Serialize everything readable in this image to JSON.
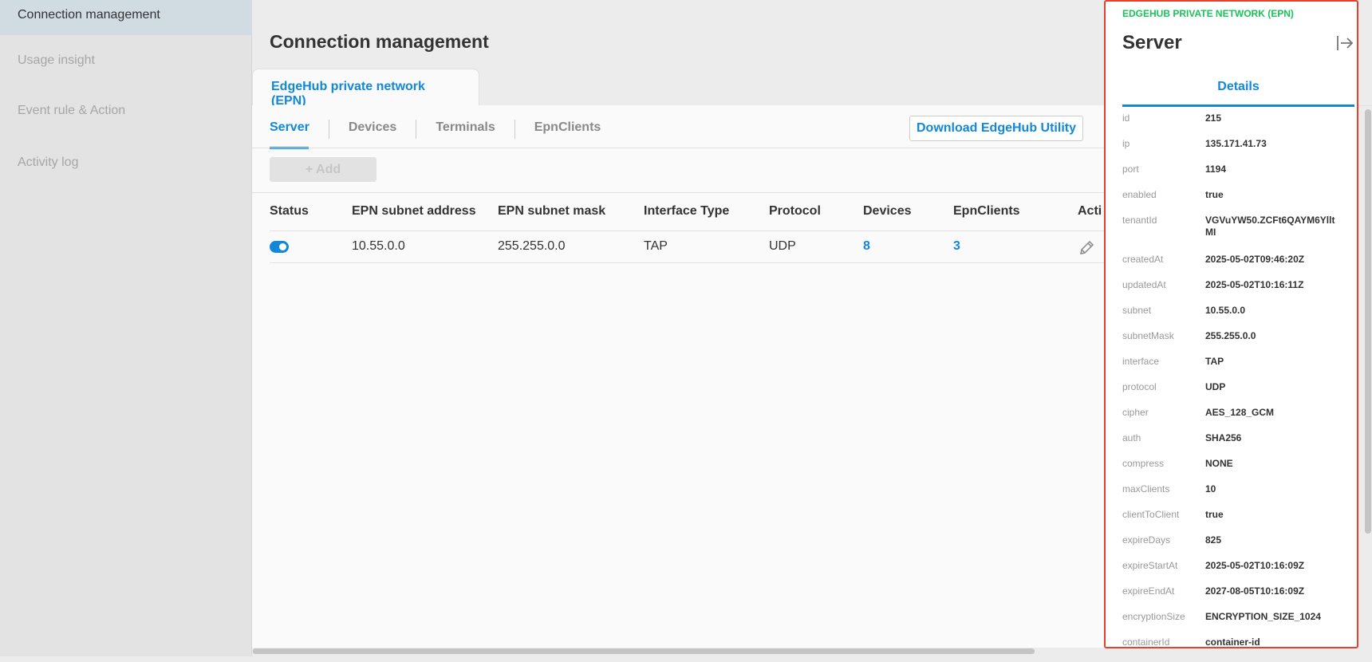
{
  "sidebar": {
    "items": [
      {
        "label": "Connection management",
        "active": true
      },
      {
        "label": "Usage insight"
      },
      {
        "label": "Event rule & Action"
      },
      {
        "label": "Activity log"
      }
    ]
  },
  "main": {
    "title": "Connection management",
    "section_tab": "EdgeHub private network (EPN)",
    "subtabs": [
      "Server",
      "Devices",
      "Terminals",
      "EpnClients"
    ],
    "download_label": "Download EdgeHub Utility",
    "add_label": "+ Add",
    "table": {
      "columns": [
        "Status",
        "EPN subnet address",
        "EPN subnet mask",
        "Interface Type",
        "Protocol",
        "Devices",
        "EpnClients",
        "Acti"
      ],
      "rows": [
        {
          "status": "on",
          "subnet": "10.55.0.0",
          "mask": "255.255.0.0",
          "interface": "TAP",
          "protocol": "UDP",
          "devices": "8",
          "epnclients": "3"
        }
      ]
    }
  },
  "panel": {
    "eyebrow": "EDGEHUB PRIVATE NETWORK (EPN)",
    "title": "Server",
    "tab": "Details",
    "fields": [
      [
        "id",
        "215"
      ],
      [
        "ip",
        "135.171.41.73"
      ],
      [
        "port",
        "1194"
      ],
      [
        "enabled",
        "true"
      ],
      [
        "tenantId",
        "VGVuYW50.ZCFt6QAYM6YlltMI"
      ],
      [
        "createdAt",
        "2025-05-02T09:46:20Z"
      ],
      [
        "updatedAt",
        "2025-05-02T10:16:11Z"
      ],
      [
        "subnet",
        "10.55.0.0"
      ],
      [
        "subnetMask",
        "255.255.0.0"
      ],
      [
        "interface",
        "TAP"
      ],
      [
        "protocol",
        "UDP"
      ],
      [
        "cipher",
        "AES_128_GCM"
      ],
      [
        "auth",
        "SHA256"
      ],
      [
        "compress",
        "NONE"
      ],
      [
        "maxClients",
        "10"
      ],
      [
        "clientToClient",
        "true"
      ],
      [
        "expireDays",
        "825"
      ],
      [
        "expireStartAt",
        "2025-05-02T10:16:09Z"
      ],
      [
        "expireEndAt",
        "2027-08-05T10:16:09Z"
      ],
      [
        "encryptionSize",
        "ENCRYPTION_SIZE_1024"
      ],
      [
        "containerId",
        "container-id"
      ]
    ]
  },
  "colors": {
    "accent": "#1188d8",
    "eyebrow": "#19c35a",
    "highlight_border": "#e8402a"
  }
}
